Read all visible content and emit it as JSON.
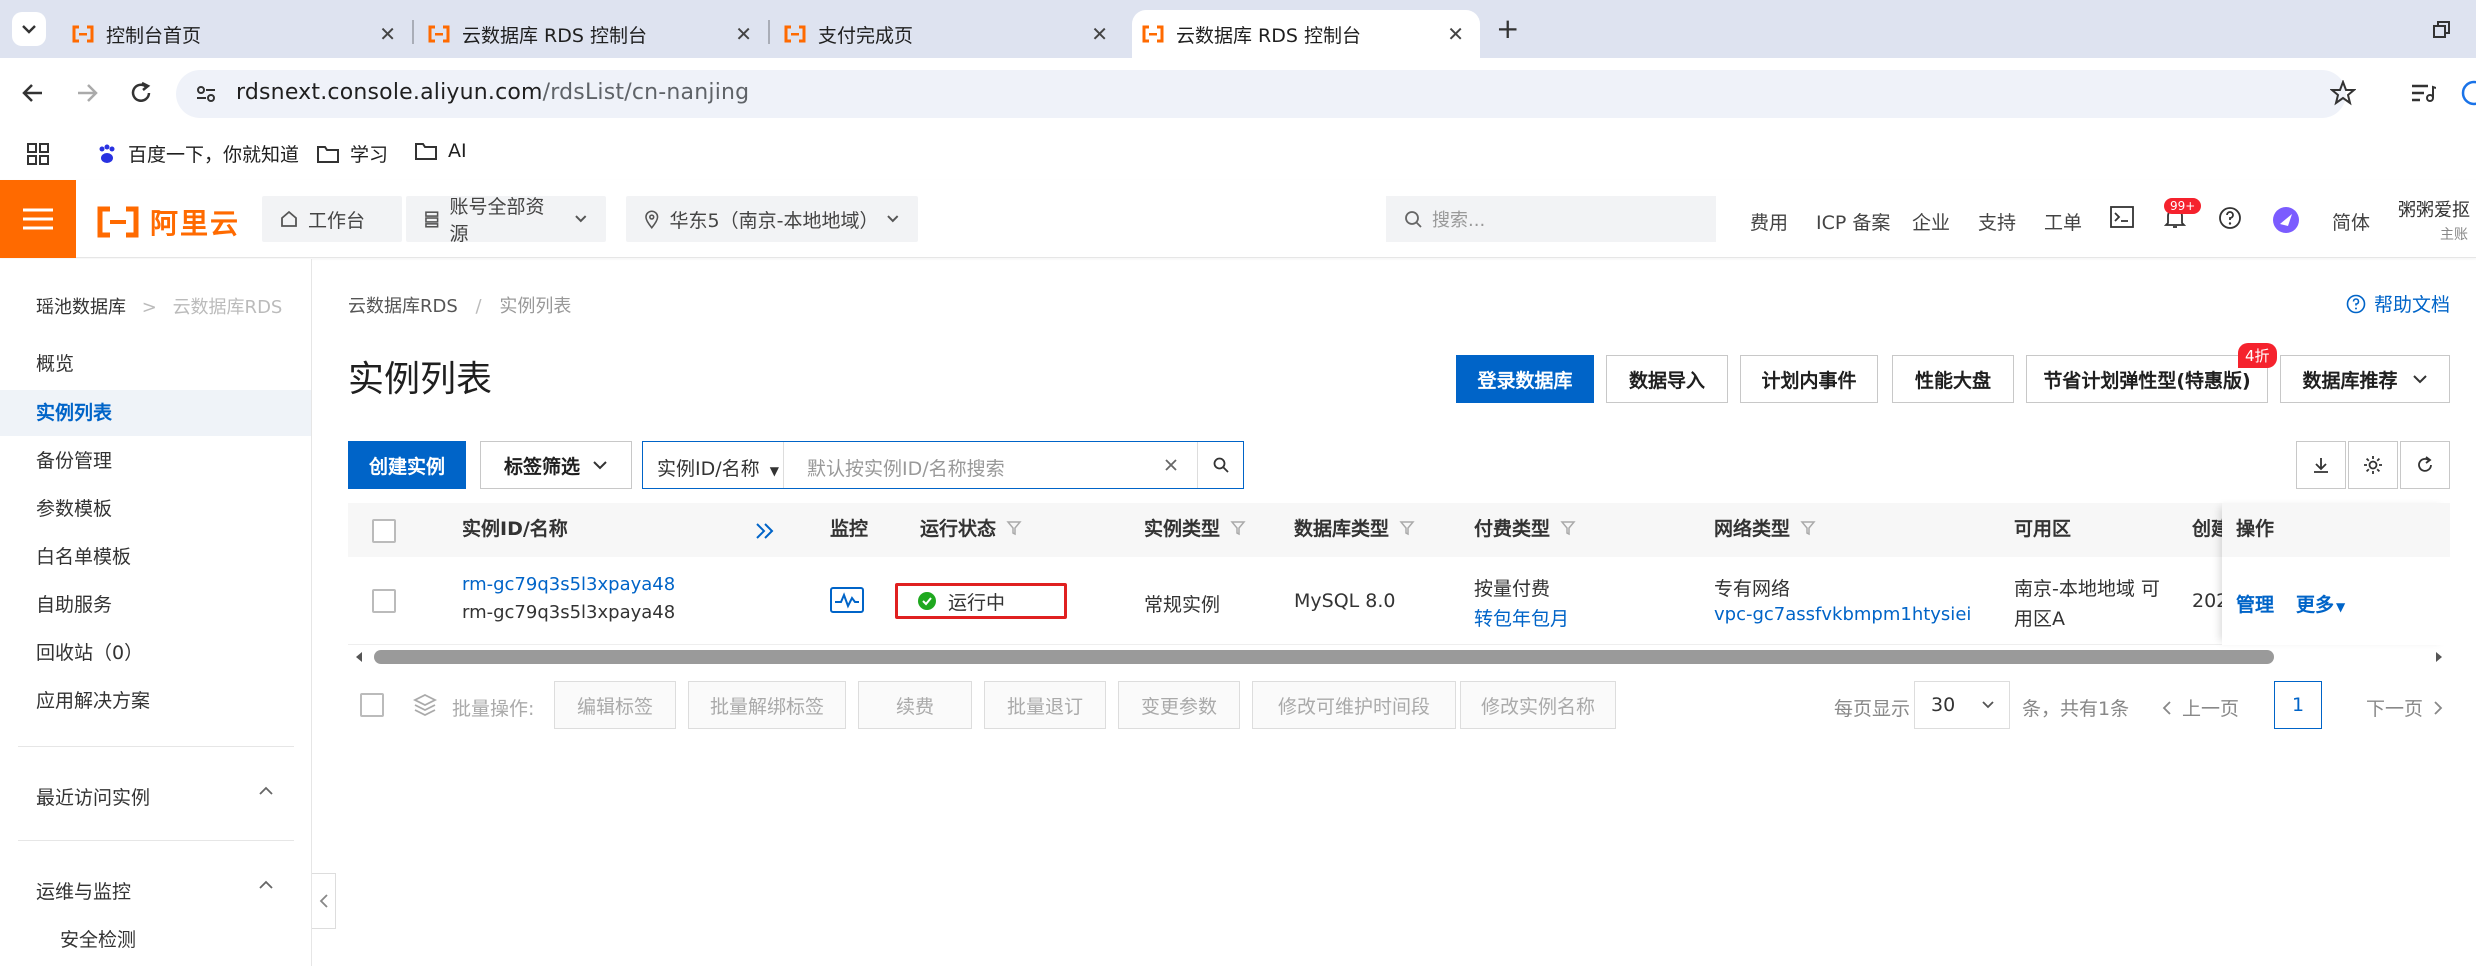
{
  "browser": {
    "tabs": [
      {
        "title": "控制台首页",
        "active": false
      },
      {
        "title": "云数据库 RDS 控制台",
        "active": false
      },
      {
        "title": "支付完成页",
        "active": false
      },
      {
        "title": "云数据库 RDS 控制台",
        "active": true
      }
    ],
    "url_host": "rdsnext.console.aliyun.com",
    "url_path": "/rdsList/cn-nanjing",
    "bookmarks": [
      "百度一下，你就知道",
      "学习",
      "AI"
    ]
  },
  "topnav": {
    "logo_text": "阿里云",
    "workbench": "工作台",
    "resources": "账号全部资源",
    "region": "华东5（南京-本地地域）",
    "search_placeholder": "搜索...",
    "links": [
      "费用",
      "ICP 备案",
      "企业",
      "支持",
      "工单"
    ],
    "notifications_badge": "99+",
    "lang": "简体",
    "user_name": "粥粥爱抠",
    "user_role": "主账"
  },
  "sidebar": {
    "breadcrumb_root": "瑶池数据库",
    "breadcrumb_sep": ">",
    "breadcrumb_sub": "云数据库RDS",
    "items": [
      {
        "label": "概览",
        "active": false
      },
      {
        "label": "实例列表",
        "active": true
      },
      {
        "label": "备份管理",
        "active": false
      },
      {
        "label": "参数模板",
        "active": false
      },
      {
        "label": "白名单模板",
        "active": false
      },
      {
        "label": "自助服务",
        "active": false
      },
      {
        "label": "回收站（0）",
        "active": false
      },
      {
        "label": "应用解决方案",
        "active": false
      }
    ],
    "group_recent": "最近访问实例",
    "group_ops": "运维与监控",
    "sub_security": "安全检测"
  },
  "main": {
    "crumb_root": "云数据库RDS",
    "crumb_sep": "/",
    "crumb_cur": "实例列表",
    "help": "帮助文档",
    "title": "实例列表",
    "actions": {
      "login_db": "登录数据库",
      "import": "数据导入",
      "planned": "计划内事件",
      "perf": "性能大盘",
      "savings": "节省计划弹性型(特惠版)",
      "savings_badge": "4折",
      "recommend": "数据库推荐"
    },
    "create": "创建实例",
    "tag_filter": "标签筛选",
    "search_type": "实例ID/名称",
    "search_placeholder": "默认按实例ID/名称搜索"
  },
  "table": {
    "headers": {
      "id": "实例ID/名称",
      "monitor": "监控",
      "status": "运行状态",
      "type": "实例类型",
      "dbtype": "数据库类型",
      "pay": "付费类型",
      "net": "网络类型",
      "zone": "可用区",
      "created": "创建",
      "ops": "操作"
    },
    "rows": [
      {
        "id": "rm-gc79q3s5l3xpaya48",
        "name": "rm-gc79q3s5l3xpaya48",
        "status": "运行中",
        "type": "常规实例",
        "dbtype": "MySQL 8.0",
        "pay": "按量付费",
        "pay_link": "转包年包月",
        "net": "专有网络",
        "vpc": "vpc-gc7assfvkbmpm1htysiei",
        "zone_line1": "南京-本地地域 可",
        "zone_line2": "用区A",
        "created": "202",
        "op_manage": "管理",
        "op_more": "更多"
      }
    ]
  },
  "bulk": {
    "label": "批量操作:",
    "buttons": [
      "编辑标签",
      "批量解绑标签",
      "续费",
      "批量退订",
      "变更参数",
      "修改可维护时间段",
      "修改实例名称"
    ]
  },
  "pagination": {
    "per_page_label": "每页显示",
    "per_page": "30",
    "total": "条，共有1条",
    "prev": "上一页",
    "current": "1",
    "next": "下一页"
  },
  "colors": {
    "brand": "#ff6a00",
    "primary": "#0064c8",
    "running": "#1fa81f",
    "highlight": "#e02020"
  }
}
